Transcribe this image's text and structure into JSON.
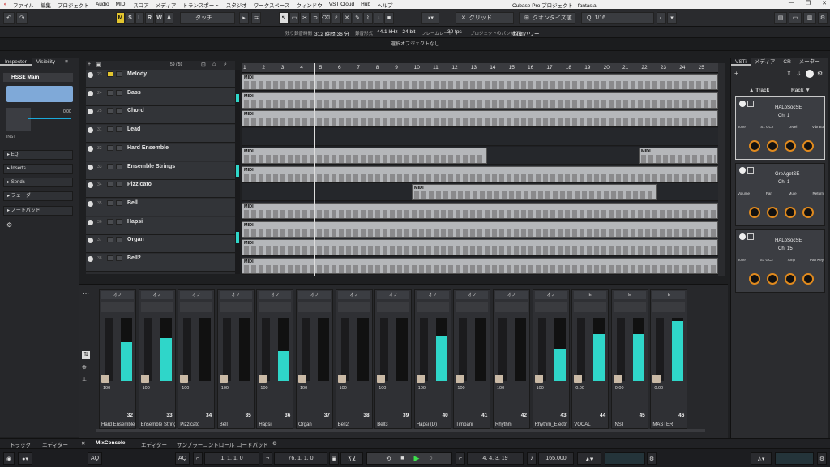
{
  "menu": [
    "ファイル",
    "編集",
    "プロジェクト",
    "Audio",
    "MIDI",
    "スコア",
    "メディア",
    "トランスポート",
    "スタジオ",
    "ワークスペース",
    "ウィンドウ",
    "VST Cloud",
    "Hub",
    "ヘルプ"
  ],
  "window_title": "Cubase Pro プロジェクト - fantasia",
  "toolbar": {
    "modes": [
      "M",
      "S",
      "L",
      "R",
      "W",
      "A"
    ],
    "touch": "タッチ",
    "grid": "グリッド",
    "quantize": "クオンタイズ値",
    "quant_val": "1/16"
  },
  "status": {
    "rec_time_label": "残り録音時間",
    "rec_time": "312 時間 36 分",
    "rec_format_label": "録音形式",
    "rec_format": "44.1 kHz - 24 bit",
    "frame_label": "フレームレート",
    "frame": "30 fps",
    "pan_label": "プロジェクトのパン補正",
    "power_label": "均衡パワー"
  },
  "info_line": "選択オブジェクトなし",
  "inspector": {
    "tab1": "Inspector",
    "tab2": "Visibility",
    "track": "HSSE Main",
    "inst": "INST",
    "sections": [
      "EQ",
      "Inserts",
      "Sends",
      "フェーダー",
      "ノートパッド"
    ],
    "count": "59 / 59",
    "vol": "0.00"
  },
  "tracks": [
    {
      "num": "23",
      "name": "Melody"
    },
    {
      "num": "24",
      "name": "Bass"
    },
    {
      "num": "25",
      "name": "Chord"
    },
    {
      "num": "31",
      "name": "Lead"
    },
    {
      "num": "32",
      "name": "Hard Ensemble"
    },
    {
      "num": "33",
      "name": "Ensemble Strings"
    },
    {
      "num": "34",
      "name": "Pizzicato"
    },
    {
      "num": "35",
      "name": "Bell"
    },
    {
      "num": "36",
      "name": "Hapsi"
    },
    {
      "num": "37",
      "name": "Organ"
    },
    {
      "num": "38",
      "name": "Bell2"
    }
  ],
  "ruler": [
    "1",
    "2",
    "3",
    "4",
    "5",
    "6",
    "7",
    "8",
    "9",
    "10",
    "11",
    "12",
    "13",
    "14",
    "15",
    "16",
    "17",
    "18",
    "19",
    "20",
    "21",
    "22",
    "23",
    "24",
    "25"
  ],
  "part_label": "MIDI",
  "mixer_channels": [
    {
      "name": "Hard Ensemble",
      "num": "32",
      "vol": "100",
      "route": "オフ",
      "level": 0.62
    },
    {
      "name": "Ensemble String",
      "num": "33",
      "vol": "100",
      "route": "オフ",
      "level": 0.68
    },
    {
      "name": "Pizzicato",
      "num": "34",
      "vol": "100",
      "route": "オフ",
      "level": 0
    },
    {
      "name": "Bell",
      "num": "35",
      "vol": "100",
      "route": "オフ",
      "level": 0
    },
    {
      "name": "Hapsi",
      "num": "36",
      "vol": "100",
      "route": "オフ",
      "level": 0.48
    },
    {
      "name": "Organ",
      "num": "37",
      "vol": "100",
      "route": "オフ",
      "level": 0
    },
    {
      "name": "Bell2",
      "num": "38",
      "vol": "100",
      "route": "オフ",
      "level": 0
    },
    {
      "name": "Bell3",
      "num": "39",
      "vol": "100",
      "route": "オフ",
      "level": 0
    },
    {
      "name": "Hapsi (D)",
      "num": "40",
      "vol": "100",
      "route": "オフ",
      "level": 0.7
    },
    {
      "name": "Timpani",
      "num": "41",
      "vol": "100",
      "route": "オフ",
      "level": 0
    },
    {
      "name": "Rhythm",
      "num": "42",
      "vol": "100",
      "route": "オフ",
      "level": 0
    },
    {
      "name": "Rhythm_Electri",
      "num": "43",
      "vol": "100",
      "route": "オフ",
      "level": 0.5
    },
    {
      "name": "VOCAL",
      "num": "44",
      "vol": "0.00",
      "route": "E",
      "level": 0.75
    },
    {
      "name": "INST",
      "num": "45",
      "vol": "0.00",
      "route": "E",
      "level": 0.75
    },
    {
      "name": "MASTER",
      "num": "46",
      "vol": "0.00",
      "route": "E",
      "level": 0.95
    }
  ],
  "vsti": {
    "tabs": [
      "VSTi",
      "メディア",
      "CR",
      "メーター"
    ],
    "track": "Track",
    "rack": "Rack",
    "slots": [
      {
        "name": "HALoSocSE",
        "ch": "Ch. 1",
        "params": [
          "Tone",
          "S1 GC2",
          "Level",
          "Vibrato"
        ]
      },
      {
        "name": "GreAgetSE",
        "ch": "Ch. 1",
        "params": [
          "Volume",
          "Pan",
          "Mute",
          "Return"
        ]
      },
      {
        "name": "HALoSocSE",
        "ch": "Ch. 15",
        "params": [
          "Tone",
          "S1 GC2",
          "Amp",
          "Pan Key"
        ]
      }
    ]
  },
  "bottom_tabs": [
    "トラック",
    "エディター",
    "MixConsole",
    "エディター",
    "サンプラーコントロール",
    "コードパッド"
  ],
  "transport": {
    "left_pos": "1. 1. 1. 0",
    "right_pos": "76. 1. 1. 0",
    "cursor": "4. 4. 3. 19",
    "tempo": "165.000"
  }
}
